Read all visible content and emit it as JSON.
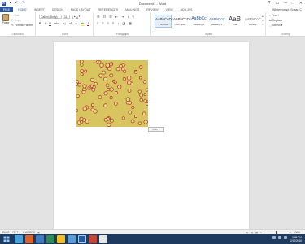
{
  "window": {
    "title": "Document1 - Word",
    "controls": [
      "?",
      "▭",
      "─",
      "□",
      "✕"
    ]
  },
  "qat": {
    "icons": [
      "word-logo",
      "save",
      "undo",
      "redo"
    ]
  },
  "tabs": {
    "file": "FILE",
    "items": [
      "HOME",
      "INSERT",
      "DESIGN",
      "PAGE LAYOUT",
      "REFERENCES",
      "MAILINGS",
      "REVIEW",
      "VIEW",
      "ADD-INS"
    ]
  },
  "user": "Winterhouse, Susan C",
  "ribbon": {
    "clipboard": {
      "paste": "Paste",
      "cut": "Cut",
      "copy": "Copy",
      "format_painter": "Format Painter",
      "label": "Clipboard"
    },
    "font": {
      "name": "Calibri (Body)",
      "size": "11",
      "label": "Font"
    },
    "paragraph": {
      "label": "Paragraph"
    },
    "styles": {
      "label": "Styles",
      "items": [
        {
          "sample": "AaBbCcDc",
          "name": "¶ Normal"
        },
        {
          "sample": "AaBbCcDc",
          "name": "¶ No Spac..."
        },
        {
          "sample": "AaBbCc",
          "name": "Heading 1"
        },
        {
          "sample": "AaBbCcC",
          "name": "Heading 2"
        },
        {
          "sample": "AaB",
          "name": "Title"
        },
        {
          "sample": "AaBbCcC",
          "name": "Subtitle"
        }
      ]
    },
    "editing": {
      "find": "Find",
      "replace": "Replace",
      "select": "Select",
      "label": "Editing"
    }
  },
  "layout_options": "(Ctrl) ▾",
  "status": {
    "page": "PAGE 1 OF 1",
    "words": "0 WORDS",
    "zoom": "100%",
    "zoom_level": 0.5
  },
  "clock": {
    "time": "5:48 PM",
    "date": "2/10/2016"
  },
  "colors": {
    "accent": "#2b579a",
    "taskbar": "#1f3a5f",
    "picture_bg": "#d8c560",
    "cell_ring": "#b5402b"
  }
}
